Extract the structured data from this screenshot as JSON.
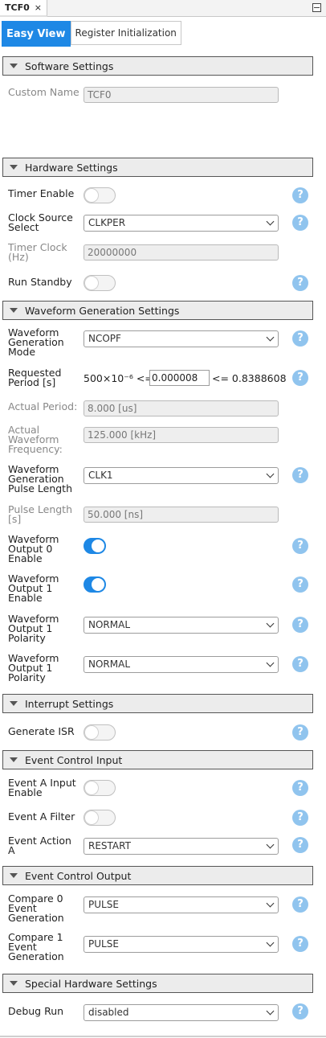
{
  "doc_tab": {
    "title": "TCF0",
    "close": "×"
  },
  "view_tabs": [
    "Easy View",
    "Register Initialization"
  ],
  "help_glyph": "?",
  "colors": {
    "accent": "#1e88e5",
    "help": "#90c4ee"
  },
  "sections": {
    "software": "Software Settings",
    "hardware": "Hardware Settings",
    "waveform": "Waveform Generation Settings",
    "interrupt": "Interrupt Settings",
    "event_in": "Event Control Input",
    "event_out": "Event Control Output",
    "special": "Special Hardware Settings"
  },
  "software": {
    "custom_name": {
      "label": "Custom Name",
      "value": "TCF0"
    }
  },
  "hardware": {
    "timer_enable": {
      "label": "Timer Enable",
      "on": false
    },
    "clock_source": {
      "label1": "Clock Source",
      "label2": "Select",
      "value": "CLKPER"
    },
    "timer_clock": {
      "label1": "Timer Clock",
      "label2": "(Hz)",
      "value": "20000000"
    },
    "run_standby": {
      "label": "Run Standby",
      "on": false
    }
  },
  "waveform": {
    "gen_mode": {
      "label1": "Waveform",
      "label2": "Generation",
      "label3": "Mode",
      "value": "NCOPF"
    },
    "requested_period": {
      "label1": "Requested",
      "label2": "Period [s]",
      "min": "500×10⁻⁶ <=",
      "value": "0.000008",
      "max": "<= 0.8388608"
    },
    "actual_period": {
      "label": "Actual Period:",
      "value": "8.000 [us]"
    },
    "actual_freq": {
      "label1": "Actual",
      "label2": "Waveform",
      "label3": "Frequency:",
      "value": "125.000 [kHz]"
    },
    "pulse_length_sel": {
      "label1": "Waveform",
      "label2": "Generation",
      "label3": "Pulse Length",
      "value": "CLK1"
    },
    "pulse_length": {
      "label1": "Pulse Length",
      "label2": "[s]",
      "value": "50.000 [ns]"
    },
    "out0_enable": {
      "label1": "Waveform",
      "label2": "Output 0",
      "label3": "Enable",
      "on": true
    },
    "out1_enable": {
      "label1": "Waveform",
      "label2": "Output 1",
      "label3": "Enable",
      "on": true
    },
    "out1_polarity_a": {
      "label1": "Waveform",
      "label2": "Output 1",
      "label3": "Polarity",
      "value": "NORMAL"
    },
    "out1_polarity_b": {
      "label1": "Waveform",
      "label2": "Output 1",
      "label3": "Polarity",
      "value": "NORMAL"
    }
  },
  "interrupt": {
    "generate_isr": {
      "label": "Generate ISR",
      "on": false
    }
  },
  "event_in": {
    "a_input_enable": {
      "label1": "Event A Input",
      "label2": "Enable",
      "on": false
    },
    "a_filter": {
      "label": "Event A Filter",
      "on": false
    },
    "a_action": {
      "label1": "Event Action",
      "label2": "A",
      "value": "RESTART"
    }
  },
  "event_out": {
    "compare0": {
      "label1": "Compare 0",
      "label2": "Event",
      "label3": "Generation",
      "value": "PULSE"
    },
    "compare1": {
      "label1": "Compare 1",
      "label2": "Event",
      "label3": "Generation",
      "value": "PULSE"
    }
  },
  "special": {
    "debug_run": {
      "label": "Debug Run",
      "value": "disabled"
    }
  }
}
